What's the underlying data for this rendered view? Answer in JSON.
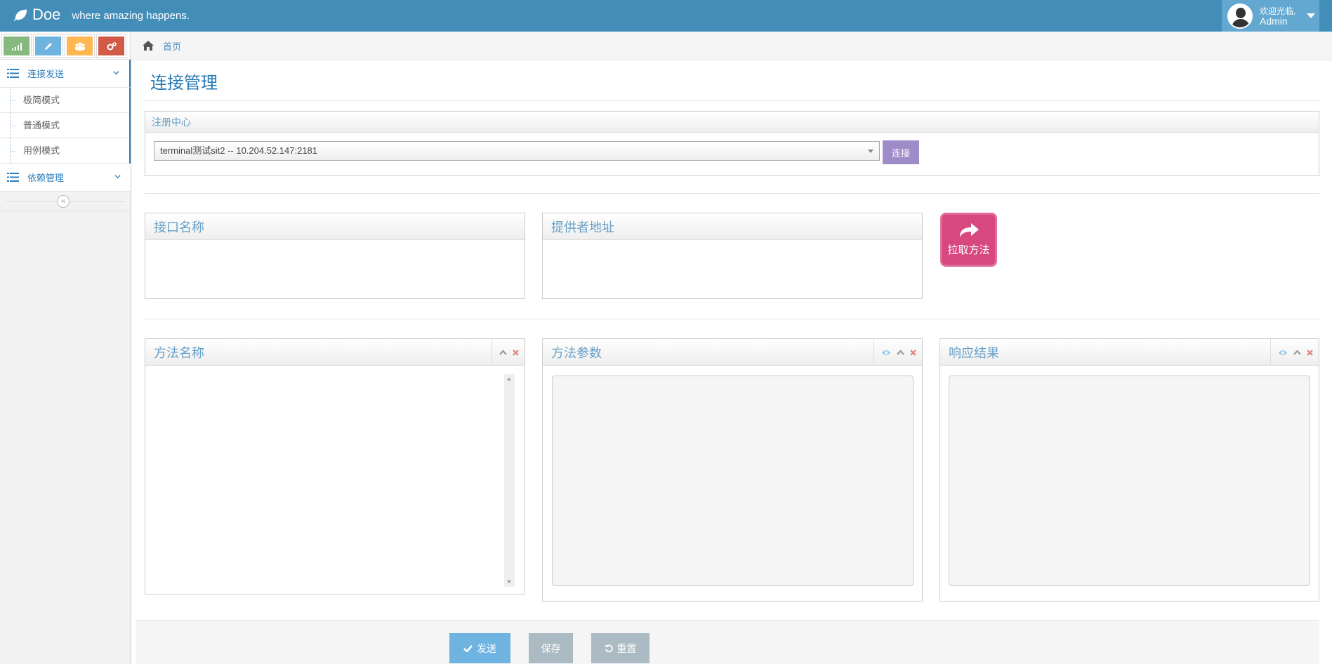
{
  "navbar": {
    "brand": "Doe",
    "tagline": "where amazing happens.",
    "welcome": "欢迎光临,",
    "username": "Admin"
  },
  "shortcuts": [
    {
      "icon": "signal-icon",
      "color": "#87b87f"
    },
    {
      "icon": "pencil-icon",
      "color": "#6fb3e0"
    },
    {
      "icon": "group-icon",
      "color": "#ffb752"
    },
    {
      "icon": "cogs-icon",
      "color": "#d15b47"
    }
  ],
  "sidebar": {
    "menu1": {
      "label": "连接发送",
      "items": [
        "极简模式",
        "普通模式",
        "用例模式"
      ]
    },
    "menu2": {
      "label": "依赖管理"
    },
    "collapse": "«"
  },
  "breadcrumb": {
    "home": "首页"
  },
  "page": {
    "title": "连接管理"
  },
  "registry": {
    "title": "注册中心",
    "selected": "terminal测试sit2 -- 10.204.52.147:2181",
    "connect_label": "连接"
  },
  "interface_panel": {
    "title": "接口名称"
  },
  "provider_panel": {
    "title": "提供者地址"
  },
  "pull_button": {
    "label": "拉取方法"
  },
  "method_panel": {
    "title": "方法名称"
  },
  "params_panel": {
    "title": "方法参数"
  },
  "response_panel": {
    "title": "响应结果"
  },
  "actions": {
    "send": "发送",
    "save": "保存",
    "reset": "重置"
  },
  "colors": {
    "navbar": "#438eb9",
    "accent": "#2679b5",
    "pull": "#d6487e",
    "connect": "#9d8cc8"
  }
}
